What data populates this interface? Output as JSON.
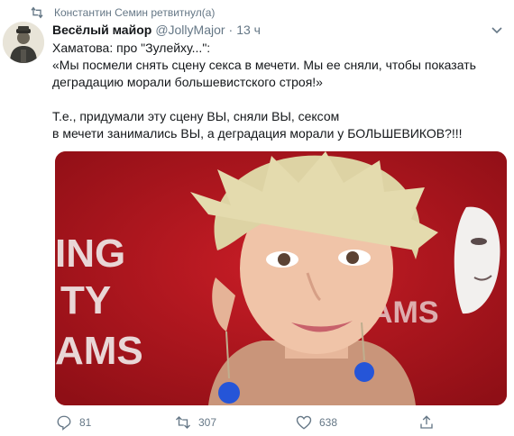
{
  "retweet_context": {
    "text": "Константин Семин ретвитнул(а)",
    "icon": "retweet-icon"
  },
  "tweet": {
    "author": {
      "display_name": "Весёлый майор",
      "handle": "@JollyMajor",
      "separator": "·",
      "time": "13 ч"
    },
    "lines": [
      "Хаматова: про \"Зулейху...\":",
      "«Мы посмели снять сцену секса в мечети. Мы ее сняли, чтобы показать\nдеградацию морали большевистского строя!»",
      "",
      "Т.е., придумали эту сцену ВЫ, сняли ВЫ, сексом\nв мечети занимались ВЫ, а деградация морали у БОЛЬШЕВИКОВ?!!!"
    ],
    "image_letters": [
      "ING",
      "TY",
      "AMS",
      "AMS"
    ]
  },
  "actions": {
    "reply_count": "81",
    "retweet_count": "307",
    "like_count": "638"
  },
  "colors": {
    "muted": "#657786",
    "text": "#14171a",
    "media_bg": "#b8161e"
  }
}
